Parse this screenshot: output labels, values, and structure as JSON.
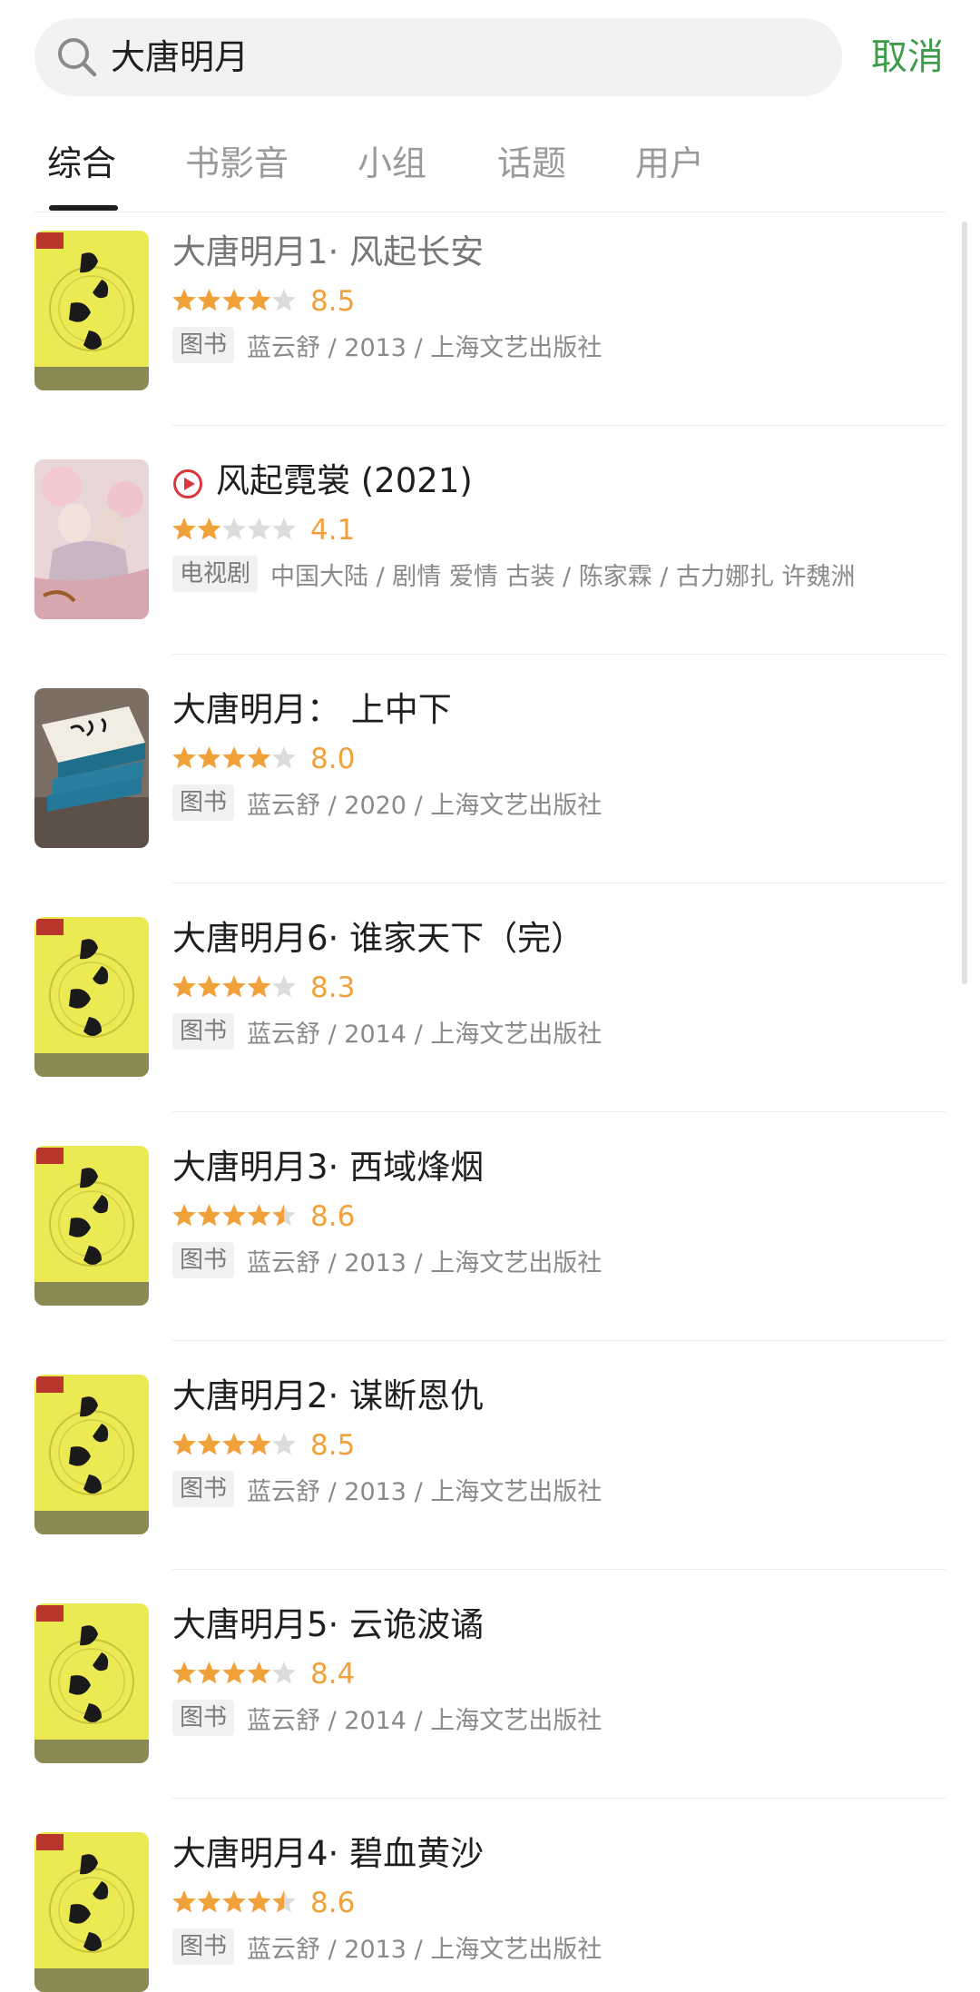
{
  "search": {
    "value": "大唐明月",
    "cancel_label": "取消"
  },
  "tabs": [
    {
      "label": "综合",
      "active": true
    },
    {
      "label": "书影音",
      "active": false
    },
    {
      "label": "小组",
      "active": false
    },
    {
      "label": "话题",
      "active": false
    },
    {
      "label": "用户",
      "active": false
    }
  ],
  "colors": {
    "accent_green": "#3d9b4a",
    "rating_orange": "#f0a13a",
    "star_empty": "#dcdcdc",
    "play_red": "#d9363e"
  },
  "results": [
    {
      "title": "大唐明月1· 风起长安",
      "stars": 4,
      "score": "8.5",
      "tag": "图书",
      "meta": "蓝云舒 / 2013 / 上海文艺出版社",
      "cover_style": "yellow-book",
      "faded": true
    },
    {
      "title": "风起霓裳 (2021)",
      "stars": 2,
      "score": "4.1",
      "tag": "电视剧",
      "meta": "中国大陆 / 剧情 爱情 古装 / 陈家霖 / 古力娜扎 许魏洲",
      "cover_style": "tv-poster",
      "icon": "play-circle-icon"
    },
    {
      "title": "大唐明月：  上中下",
      "stars": 4,
      "score": "8.0",
      "tag": "图书",
      "meta": "蓝云舒 / 2020 / 上海文艺出版社",
      "cover_style": "boxed-set"
    },
    {
      "title": "大唐明月6· 谁家天下（完）",
      "stars": 4,
      "score": "8.3",
      "tag": "图书",
      "meta": "蓝云舒 / 2014 / 上海文艺出版社",
      "cover_style": "yellow-book"
    },
    {
      "title": "大唐明月3· 西域烽烟",
      "stars": 4.5,
      "score": "8.6",
      "tag": "图书",
      "meta": "蓝云舒 / 2013 / 上海文艺出版社",
      "cover_style": "yellow-book"
    },
    {
      "title": "大唐明月2· 谋断恩仇",
      "stars": 4,
      "score": "8.5",
      "tag": "图书",
      "meta": "蓝云舒 / 2013 / 上海文艺出版社",
      "cover_style": "yellow-book"
    },
    {
      "title": "大唐明月5· 云诡波谲",
      "stars": 4,
      "score": "8.4",
      "tag": "图书",
      "meta": "蓝云舒 / 2014 / 上海文艺出版社",
      "cover_style": "yellow-book"
    },
    {
      "title": "大唐明月4· 碧血黄沙",
      "stars": 4.5,
      "score": "8.6",
      "tag": "图书",
      "meta": "蓝云舒 / 2013 / 上海文艺出版社",
      "cover_style": "yellow-book"
    }
  ]
}
